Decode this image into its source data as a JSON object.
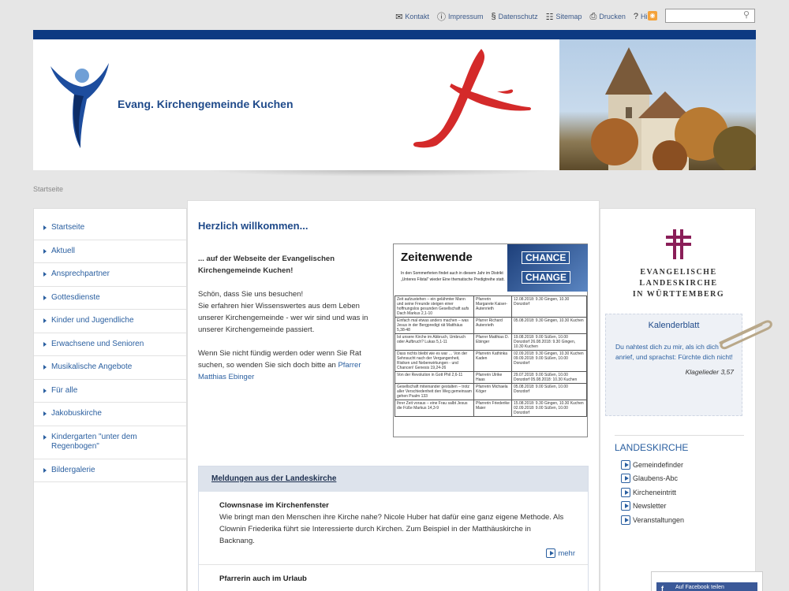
{
  "toplinks": [
    {
      "label": "Kontakt",
      "icon": "envelope-icon"
    },
    {
      "label": "Impressum",
      "icon": "info-icon"
    },
    {
      "label": "Datenschutz",
      "icon": "paragraph-icon"
    },
    {
      "label": "Sitemap",
      "icon": "sitemap-icon"
    },
    {
      "label": "Drucken",
      "icon": "print-icon"
    },
    {
      "label": "Hilfe",
      "icon": "help-icon"
    }
  ],
  "search": {
    "placeholder": ""
  },
  "header": {
    "title": "Evang. Kirchengemeinde Kuchen"
  },
  "breadcrumb": "Startseite",
  "nav": [
    "Startseite",
    "Aktuell",
    "Ansprechpartner",
    "Gottesdienste",
    "Kinder und Jugendliche",
    "Erwachsene und Senioren",
    "Musikalische Angebote",
    "Für alle",
    "Jakobuskirche",
    "Kindergarten \"unter dem Regenbogen\"",
    "Bildergalerie"
  ],
  "main": {
    "heading": "Herzlich willkommen...",
    "intro_bold": "... auf der Webseite der Evangelischen Kirchengemeinde Kuchen!",
    "para1_a": "Schön, dass Sie uns besuchen!",
    "para1_b": "Sie erfahren hier Wissenswertes aus dem Leben unserer Kirchengemeinde - wer wir sind und was in unserer Kirchengemeinde passiert.",
    "para2": "Wenn Sie nicht fündig werden oder wenn Sie Rat suchen, so wenden Sie sich doch bitte an",
    "para2_link": "Pfarrer Matthias Ebinger"
  },
  "poster": {
    "title": "Zeitenwende",
    "sub": "In den Sommerferien findet auch in diesem Jahr im Distrikt „Unteres Filstal“ wieder Eine thematische Predigtreihe statt.",
    "chance1": "CHANCE",
    "chance2": "CHANGE",
    "rows": [
      [
        "Zeit aufzustehen – ein gelähmter Mann und seine Freunde steigen einer hoffnungslos gesunden Gesellschaft aufs Dach Markus 2,1-10",
        "Pfarrerin Margarete Kaiser-Autenrieth",
        "12.08.2018: 9.30 Gingen, 10.30 Donzdorf"
      ],
      [
        "Einfach mal etwas anders machen – was Jesus in der Bergpredigt rät Matthäus 5,38-48",
        "Pfarrer Richard Autenrieth",
        "05.08.2018: 9.30 Gingen, 10.30 Kuchen"
      ],
      [
        "Ist unsere Kirche im Abbruch, Umbruch oder Aufbruch? Lukas 5,1-11",
        "Pfarrer Matthias D. Ebinger",
        "19.08.2018: 9.00 Süßen, 10.00 Donzdorf 26.08.2018: 9.30 Gingen, 10.30 Kuchen"
      ],
      [
        "Dass nichts bleibt wie es war … Von der Sehnsucht nach der Vergangenheit, Risiken und Nebenwirkungen - und Chancen! Genesis 19,24-26",
        "Pfarrerin Kathinka Kaden",
        "02.09.2018: 9.30 Gingen, 10.30 Kuchen 09.09.2018: 9.00 Süßen, 10.00 Donzdorf"
      ],
      [
        "Von der Revolution in Gott Phil 2,6-11",
        "Pfarrerin Ulrike Haas",
        "29.07.2018: 9.00 Süßen, 10.00 Donzdorf 05.08.2018: 10.30 Kuchen"
      ],
      [
        "Gesellschaft miteinander gestalten – trotz aller Verschiedenheit den Weg gemeinsam gehen Psalm 133",
        "Pfarrerin Michaela Köger",
        "05.08.2018: 9.00 Süßen, 10.00 Donzdorf"
      ],
      [
        "Ihrer Zeit voraus – eine Frau salbt Jesus die Füße Markus 14,3-9",
        "Pfarrerin Friederike Maier",
        "15.08.2018: 9.30 Gingen, 10.30 Kuchen 02.09.2018: 9.00 Süßen, 10.00 Donzdorf"
      ]
    ]
  },
  "news": {
    "heading": "Meldungen aus der Landeskirche",
    "items": [
      {
        "title": "Clownsnase im Kirchenfenster",
        "text": "Wie bringt man den Menschen ihre Kirche nahe? Nicole Huber hat dafür eine ganz eigene Methode. Als Clownin Friederika führt sie Interessierte durch Kirchen. Zum Beispiel in der Matthäuskirche in Backnang.",
        "more": "mehr"
      },
      {
        "title": "Pfarrerin auch im Urlaub"
      }
    ]
  },
  "sidebar": {
    "elk_line1": "Evangelische Landeskirche",
    "elk_line2": "in Württemberg",
    "kalender_title": "Kalenderblatt",
    "kalender_text": "Du nahtest dich zu mir, als ich dich anrief, und sprachst: Fürchte dich nicht!",
    "kalender_ref": "Klagelieder 3,57",
    "landes_heading": "LANDESKIRCHE",
    "landes_links": [
      "Gemeindefinder",
      "Glaubens-Abc",
      "Kircheneintritt",
      "Newsletter",
      "Veranstaltungen"
    ],
    "facebook": "Auf Facebook teilen"
  },
  "colors": {
    "brand_blue": "#0d3a82",
    "link_blue": "#2a5fa0",
    "cross_purple": "#8a1e58",
    "deco_red": "#d42a2a"
  }
}
